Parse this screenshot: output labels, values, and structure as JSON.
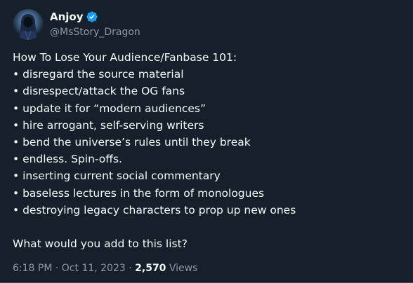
{
  "author": {
    "display_name": "Anjoy",
    "handle": "@MsStory_Dragon",
    "verified": true,
    "verified_icon": "verified-badge-icon",
    "avatar": "hooded-figure-avatar"
  },
  "tweet": {
    "heading": "How To Lose Your Audience/Fanbase 101:",
    "items": [
      "• disregard the source material",
      "• disrespect/attack the OG fans",
      "• update it for “modern audiences”",
      "• hire arrogant, self-serving writers",
      "• bend the universe’s rules until they break",
      "• endless. Spin-offs.",
      "• inserting current social commentary",
      "• baseless lectures in the form of monologues",
      "• destroying legacy characters to prop up new ones"
    ],
    "question": "What would you add to this list?"
  },
  "meta": {
    "time": "6:18 PM",
    "separator_1": " · ",
    "date": "Oct 11, 2023",
    "separator_2": " · ",
    "views_count": "2,570",
    "views_label": " Views"
  },
  "colors": {
    "background": "#15202b",
    "text": "#f7f9f9",
    "secondary_text": "#8b98a5",
    "verified_badge": "#1d9bf0"
  }
}
